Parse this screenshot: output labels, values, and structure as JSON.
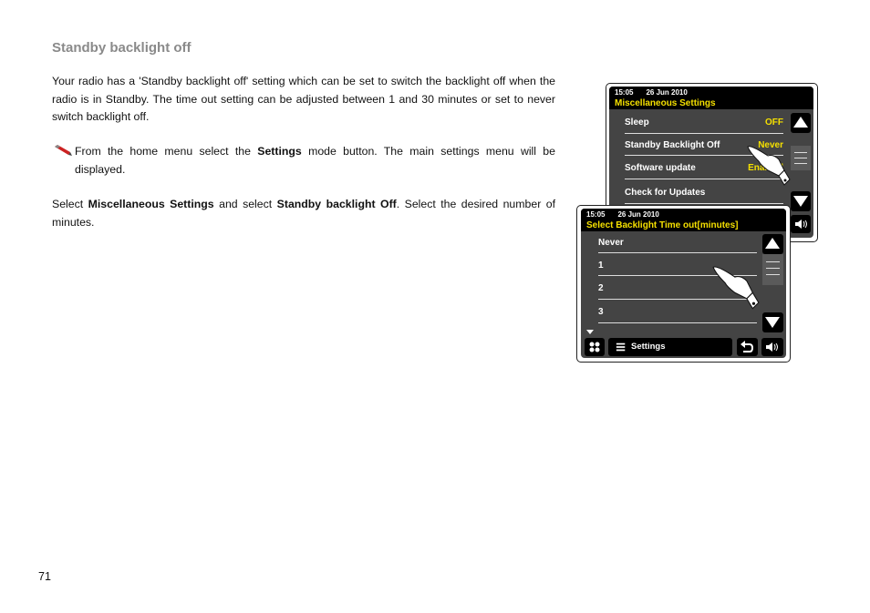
{
  "heading": "Standby backlight off",
  "paragraphs": {
    "p1": "Your radio has a 'Standby backlight off' setting which can be set to switch the backlight off when the radio is in Standby. The time out setting can be adjusted between 1 and 30 minutes or set to never switch backlight off.",
    "p2_pre": "From the home menu select the ",
    "p2_bold": "Settings",
    "p2_post": " mode button. The main settings menu will be displayed.",
    "p3_a": "Select ",
    "p3_b": "Miscellaneous Settings",
    "p3_c": " and select ",
    "p3_d": "Standby backlight Off",
    "p3_e": ". Select the desired number of minutes."
  },
  "page_number": "71",
  "screen_back": {
    "time": "15:05",
    "date": "26 Jun 2010",
    "title": "Miscellaneous Settings",
    "items": [
      {
        "label": "Sleep",
        "value": "OFF"
      },
      {
        "label": "Standby Backlight Off",
        "value": "Never"
      },
      {
        "label": "Software update",
        "value": "Enabled"
      },
      {
        "label": "Check for Updates",
        "value": ""
      }
    ]
  },
  "screen_front": {
    "time": "15:05",
    "date": "26 Jun 2010",
    "title": "Select Backlight Time out[minutes]",
    "items": [
      "Never",
      "1",
      "2",
      "3"
    ],
    "bottom_label": "Settings"
  },
  "colors": {
    "accent_yellow": "#f5e000",
    "screen_bg": "#444444",
    "heading_gray": "#8a8a8a"
  }
}
